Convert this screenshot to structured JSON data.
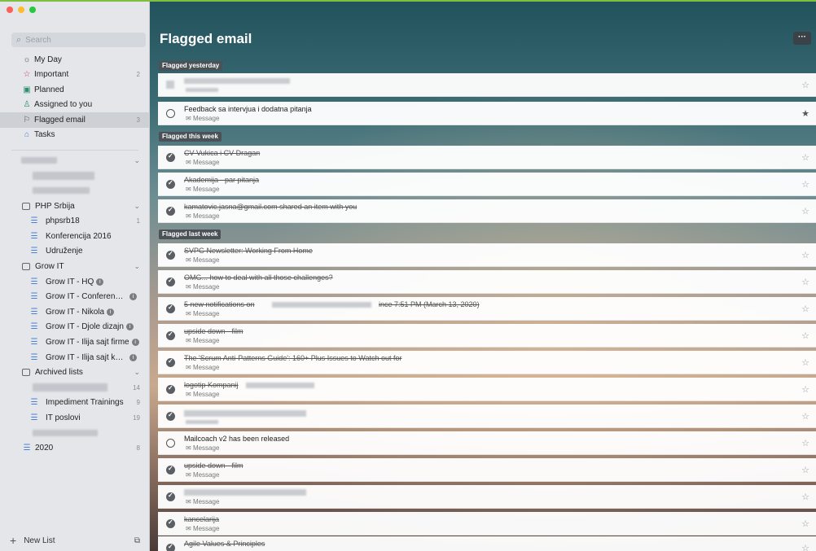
{
  "search": {
    "placeholder": "Search"
  },
  "nav": [
    {
      "label": "My Day",
      "icon": "sun-icon",
      "count": ""
    },
    {
      "label": "Important",
      "icon": "star-icon",
      "count": "2"
    },
    {
      "label": "Planned",
      "icon": "calendar-icon",
      "count": ""
    },
    {
      "label": "Assigned to you",
      "icon": "person-icon",
      "count": ""
    },
    {
      "label": "Flagged email",
      "icon": "flag-icon",
      "count": "3"
    },
    {
      "label": "Tasks",
      "icon": "home-icon",
      "count": ""
    }
  ],
  "lists": {
    "php_group": "PHP Srbija",
    "phpsrb18": {
      "label": "phpsrb18",
      "count": "1"
    },
    "konferencija": "Konferencija 2016",
    "udruzenje": "Udruženje",
    "grow_group": "Grow IT",
    "grow_items": [
      "Grow IT - HQ",
      "Grow IT - Conference...",
      "Grow IT - Nikola",
      "Grow IT - Djole dizajn",
      "Grow IT - Ilija sajt firme",
      "Grow IT - Ilija sajt konf..."
    ],
    "archived_group": "Archived lists",
    "archived_blur_count": "14",
    "impediment": {
      "label": "Impediment Trainings",
      "count": "9"
    },
    "it_poslovi": {
      "label": "IT poslovi",
      "count": "19"
    },
    "y2020": {
      "label": "2020",
      "count": "8"
    }
  },
  "new_list": "New List",
  "main": {
    "title": "Flagged email",
    "more": "···",
    "sections": [
      "Flagged yesterday",
      "Flagged this week",
      "Flagged last week"
    ],
    "tasks": [
      {
        "title": "",
        "sub": "Message",
        "done": false,
        "starred": false
      },
      {
        "title": "Feedback sa intervjua i dodatna pitanja",
        "sub": "Message",
        "done": false,
        "starred": true
      },
      {
        "title": "CV Vukica i CV Dragan",
        "sub": "Message",
        "done": true,
        "starred": false
      },
      {
        "title": "Akademija - par pitanja",
        "sub": "Message",
        "done": true,
        "starred": false
      },
      {
        "title": "kamatovic.jasna@gmail.com shared an item with you",
        "sub": "Message",
        "done": true,
        "starred": false
      },
      {
        "title": "SVPG Newsletter: Working From Home",
        "sub": "Message",
        "done": true,
        "starred": false
      },
      {
        "title": "OMG... how to deal with all those challenges?",
        "sub": "Message",
        "done": true,
        "starred": false
      },
      {
        "title": "5 new notifications on",
        "title_tail": "ince 7:51 PM (March 13, 2020)",
        "sub": "Message",
        "done": true,
        "starred": false
      },
      {
        "title": "upside down - film",
        "sub": "Message",
        "done": true,
        "starred": false
      },
      {
        "title": "The 'Scrum Anti-Patterns Guide': 160+ Plus Issues to Watch out for",
        "sub": "Message",
        "done": true,
        "starred": false
      },
      {
        "title": "logotip Kompanij",
        "sub": "Message",
        "done": true,
        "starred": false
      },
      {
        "title": "",
        "sub": "Message",
        "done": true,
        "starred": false
      },
      {
        "title": "Mailcoach v2 has been released",
        "sub": "Message",
        "done": false,
        "starred": false
      },
      {
        "title": "upside down - film",
        "sub": "Message",
        "done": true,
        "starred": false
      },
      {
        "title": "",
        "sub": "Message",
        "done": true,
        "starred": false
      },
      {
        "title": "kancelarija",
        "sub": "Message",
        "done": true,
        "starred": false
      },
      {
        "title": "Agile Values & Principles",
        "sub": "Message",
        "done": true,
        "starred": false
      }
    ]
  }
}
